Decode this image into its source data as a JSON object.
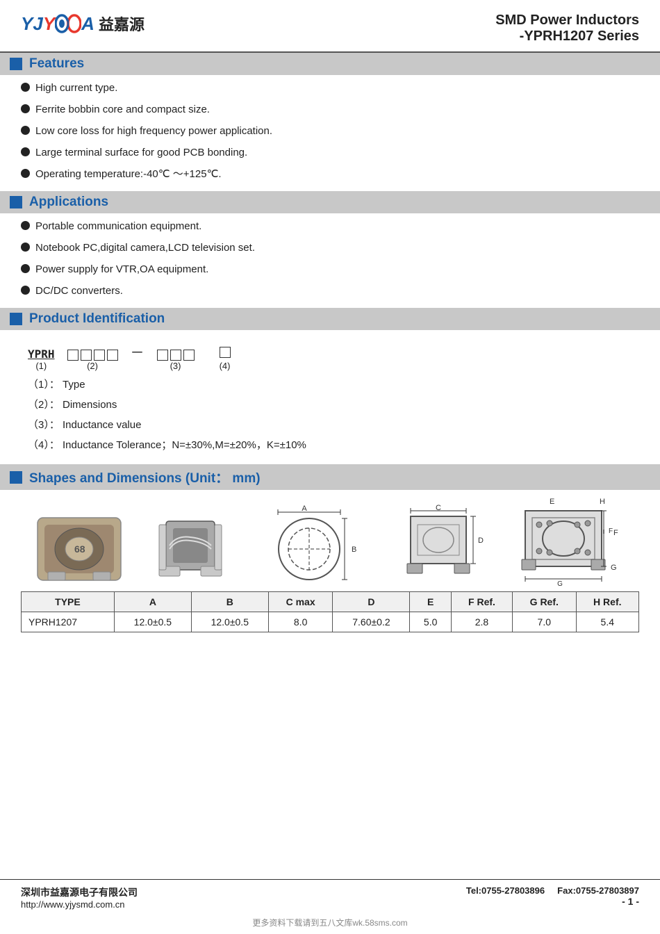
{
  "header": {
    "title_line1": "SMD Power Inductors",
    "title_line2": "-YPRH1207 Series",
    "logo_text_cn": "益嘉源",
    "logo_brand": "YJYCOIA"
  },
  "features": {
    "section_title": "Features",
    "items": [
      "High current type.",
      "Ferrite bobbin core and compact size.",
      "Low core loss for high frequency power application.",
      "Large terminal surface for good PCB bonding.",
      "Operating temperature:-40℃ ～+125℃."
    ]
  },
  "applications": {
    "section_title": "Applications",
    "items": [
      "Portable communication equipment.",
      "Notebook PC,digital camera,LCD television set.",
      "Power supply for VTR,OA equipment.",
      "DC/DC converters."
    ]
  },
  "product_identification": {
    "section_title": "Product Identification",
    "prefix": "YPRH",
    "label1": "(1)",
    "label2": "(2)",
    "label3": "(3)",
    "label4": "(4)",
    "details": [
      {
        "num": "（1）",
        "sep": "：",
        "desc": "Type"
      },
      {
        "num": "（2）",
        "sep": "：",
        "desc": "Dimensions"
      },
      {
        "num": "（3）",
        "sep": "：",
        "desc": "Inductance value"
      },
      {
        "num": "（4）",
        "sep": "：",
        "desc": "Inductance Tolerance；N=±30%,M=±20%，K=±10%"
      }
    ]
  },
  "shapes": {
    "section_title": "Shapes and Dimensions (Unit：  mm)",
    "table": {
      "headers": [
        "TYPE",
        "A",
        "B",
        "C max",
        "D",
        "E",
        "F Ref.",
        "G Ref.",
        "H Ref."
      ],
      "rows": [
        [
          "YPRH1207",
          "12.0±0.5",
          "12.0±0.5",
          "8.0",
          "7.60±0.2",
          "5.0",
          "2.8",
          "7.0",
          "5.4"
        ]
      ]
    }
  },
  "footer": {
    "company_cn": "深圳市益嘉源电子有限公司",
    "website": "http://www.yjysmd.com.cn",
    "tel": "Tel:0755-27803896",
    "fax": "Fax:0755-27803897",
    "page": "- 1 -"
  },
  "watermark": "更多资料下载请到五八文库wk.58sms.com"
}
